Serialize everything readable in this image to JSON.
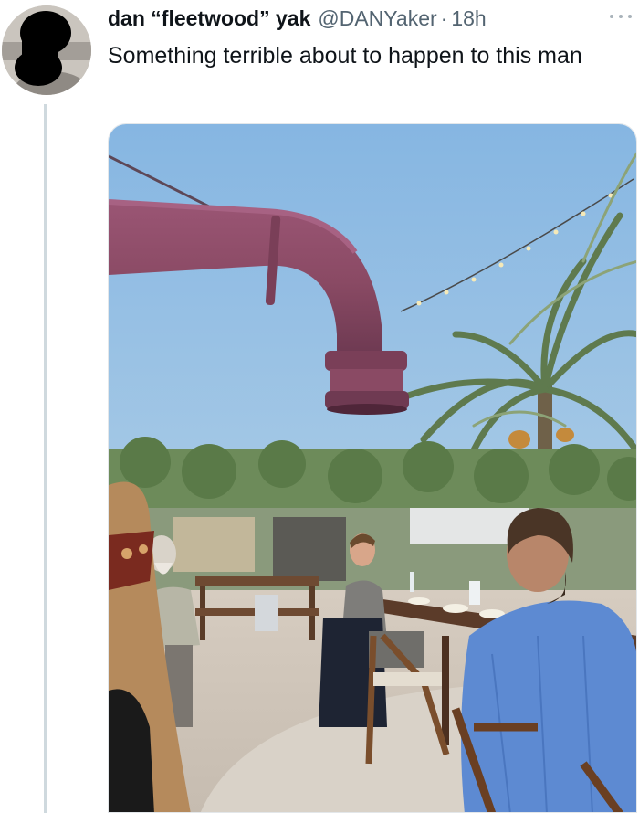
{
  "tweet": {
    "display_name": "dan “fleetwood” yak",
    "handle": "@DANYaker",
    "separator": "·",
    "time": "18h",
    "text": "Something terrible about to happen to this man",
    "avatar_icon": "profile-avatar",
    "more_icon": "more-horizontal-icon"
  },
  "media": {
    "kind": "photo",
    "icons": [
      "drain-pipe",
      "palm-tree",
      "string-lights",
      "dining-table",
      "person"
    ]
  },
  "colors": {
    "pipe": "#8a4a64",
    "sky": "#9fc6e6",
    "text": "#0f1419",
    "muted": "#536471"
  }
}
